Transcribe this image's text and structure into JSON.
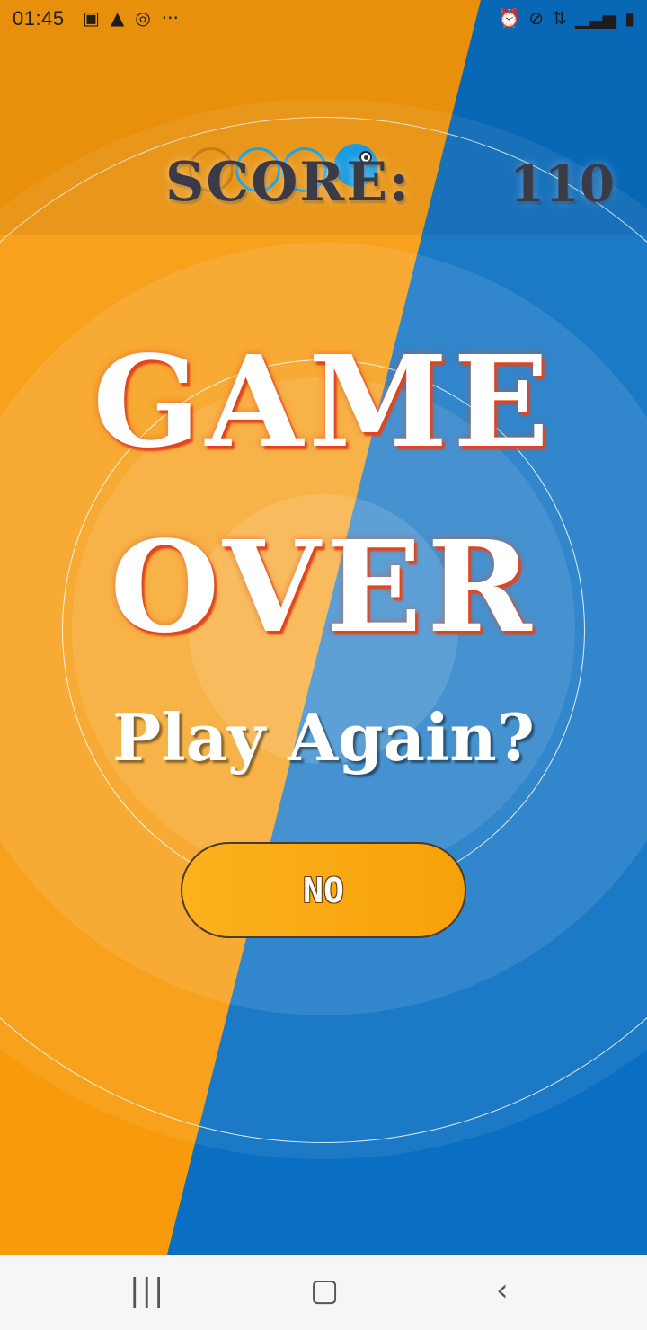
{
  "status_bar": {
    "time": "01:45",
    "left_icons": [
      "image-icon",
      "warning-icon",
      "whatsapp-icon",
      "more-icon"
    ],
    "right_icons": [
      "alarm-icon",
      "do-not-disturb-icon",
      "data-icon",
      "signal-icon",
      "battery-icon"
    ]
  },
  "score": {
    "label": "SCORE:",
    "value": "110"
  },
  "game_over": {
    "line1": "GAME",
    "line2": "OVER",
    "prompt": "Play Again?"
  },
  "buttons": {
    "no_label": "NO"
  },
  "navigation": {
    "recent_glyph": "|||",
    "home_glyph": "▢",
    "back_glyph": "‹"
  },
  "colors": {
    "orange": "#f79a0c",
    "blue": "#0a6fc2",
    "title_shadow": "#e0451c"
  }
}
